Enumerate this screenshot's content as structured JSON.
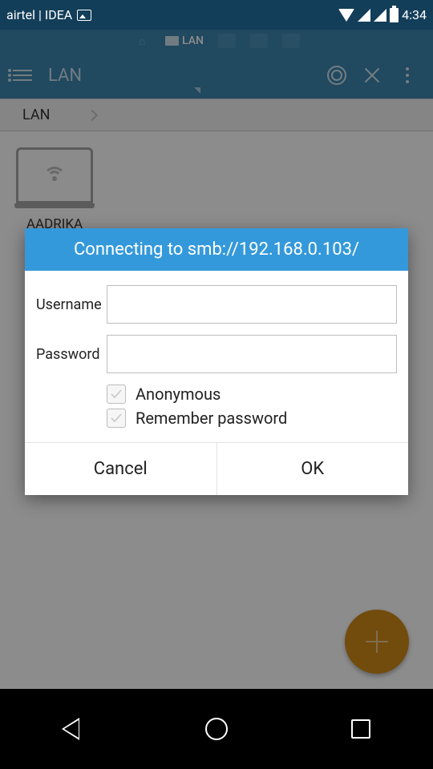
{
  "status": {
    "carrier": "airtel | IDEA",
    "time": "4:34"
  },
  "tabstrip": {
    "active_label": "LAN"
  },
  "toolbar": {
    "title": "LAN"
  },
  "breadcrumb": "LAN",
  "device": {
    "name": "AADRIKA"
  },
  "dialog": {
    "title": "Connecting to smb://192.168.0.103/",
    "username_label": "Username",
    "username_value": "",
    "password_label": "Password",
    "password_value": "",
    "anonymous_label": "Anonymous",
    "anonymous_checked": false,
    "remember_label": "Remember password",
    "remember_checked": false,
    "cancel": "Cancel",
    "ok": "OK"
  }
}
